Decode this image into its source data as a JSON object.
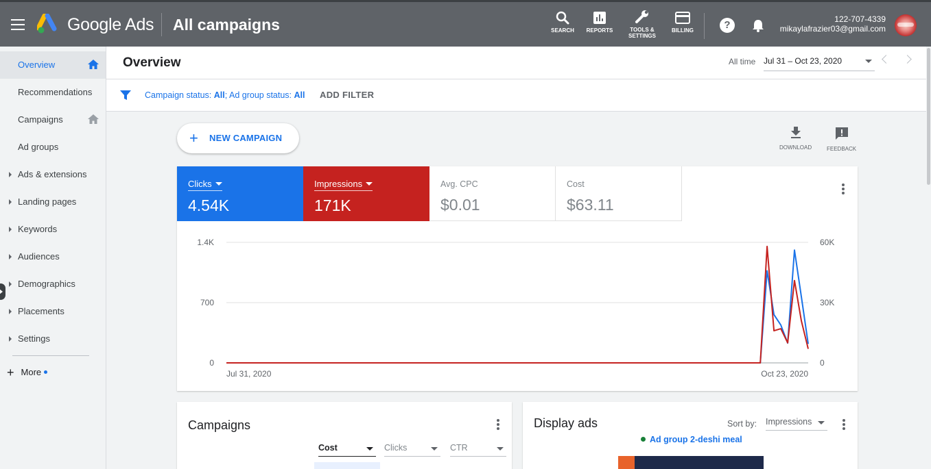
{
  "topbar": {
    "brand": "Google Ads",
    "page_heading": "All campaigns",
    "tools": [
      {
        "label_line1": "SEARCH",
        "label_line2": ""
      },
      {
        "label_line1": "REPORTS",
        "label_line2": ""
      },
      {
        "label_line1": "TOOLS &",
        "label_line2": "SETTINGS"
      },
      {
        "label_line1": "BILLING",
        "label_line2": ""
      }
    ],
    "account_phone": "122-707-4339",
    "account_email": "mikaylafrazier03@gmail.com"
  },
  "sidebar": {
    "items": [
      {
        "label": "Overview"
      },
      {
        "label": "Recommendations"
      },
      {
        "label": "Campaigns"
      },
      {
        "label": "Ad groups"
      },
      {
        "label": "Ads & extensions"
      },
      {
        "label": "Landing pages"
      },
      {
        "label": "Keywords"
      },
      {
        "label": "Audiences"
      },
      {
        "label": "Demographics"
      },
      {
        "label": "Placements"
      },
      {
        "label": "Settings"
      }
    ],
    "more_label": "More"
  },
  "header": {
    "title": "Overview",
    "range_label": "All time",
    "range_value": "Jul 31 – Oct 23, 2020"
  },
  "filter": {
    "campaign_status_label": "Campaign status:",
    "campaign_status_value": "All",
    "ad_group_status_label": "; Ad group status:",
    "ad_group_status_value": "All",
    "add_filter_label": "ADD FILTER"
  },
  "actions": {
    "new_campaign_label": "NEW CAMPAIGN",
    "download_label": "DOWNLOAD",
    "feedback_label": "FEEDBACK"
  },
  "metrics": {
    "clicks_label": "Clicks",
    "clicks_value": "4.54K",
    "impressions_label": "Impressions",
    "impressions_value": "171K",
    "cpc_label": "Avg. CPC",
    "cpc_value": "$0.01",
    "cost_label": "Cost",
    "cost_value": "$63.11"
  },
  "colors": {
    "clicks": "#1a73e8",
    "impressions": "#c5221f"
  },
  "chart_data": {
    "type": "line",
    "x_start_label": "Jul 31, 2020",
    "x_end_label": "Oct 23, 2020",
    "left_axis": {
      "ticks": [
        "1.4K",
        "700",
        "0"
      ],
      "ylim": [
        0,
        1400
      ]
    },
    "right_axis": {
      "ticks": [
        "60K",
        "30K",
        "0"
      ],
      "ylim": [
        0,
        60000
      ]
    },
    "num_days": 85,
    "series": [
      {
        "name": "Clicks",
        "axis": "left",
        "color": "#1a73e8",
        "values": [
          0,
          0,
          0,
          0,
          0,
          0,
          0,
          0,
          0,
          0,
          0,
          0,
          0,
          0,
          0,
          0,
          0,
          0,
          0,
          0,
          0,
          0,
          0,
          0,
          0,
          0,
          0,
          0,
          0,
          0,
          0,
          0,
          0,
          0,
          0,
          0,
          0,
          0,
          0,
          0,
          0,
          0,
          0,
          0,
          0,
          0,
          0,
          0,
          0,
          0,
          0,
          0,
          0,
          0,
          0,
          0,
          0,
          0,
          0,
          0,
          0,
          0,
          0,
          0,
          0,
          0,
          0,
          0,
          0,
          0,
          0,
          0,
          0,
          0,
          0,
          0,
          0,
          0,
          0,
          1070,
          560,
          440,
          230,
          1310,
          770,
          220
        ]
      },
      {
        "name": "Impressions",
        "axis": "right",
        "color": "#c5221f",
        "values": [
          0,
          0,
          0,
          0,
          0,
          0,
          0,
          0,
          0,
          0,
          0,
          0,
          0,
          0,
          0,
          0,
          0,
          0,
          0,
          0,
          0,
          0,
          0,
          0,
          0,
          0,
          0,
          0,
          0,
          0,
          0,
          0,
          0,
          0,
          0,
          0,
          0,
          0,
          0,
          0,
          0,
          0,
          0,
          0,
          0,
          0,
          0,
          0,
          0,
          0,
          0,
          0,
          0,
          0,
          0,
          0,
          0,
          0,
          0,
          0,
          0,
          0,
          0,
          0,
          0,
          0,
          0,
          0,
          0,
          0,
          0,
          0,
          0,
          0,
          0,
          0,
          0,
          0,
          0,
          58000,
          16000,
          17000,
          10000,
          41000,
          21000,
          7000
        ]
      }
    ]
  },
  "campaigns_card": {
    "title": "Campaigns",
    "columns": [
      "Cost",
      "Clicks",
      "CTR"
    ]
  },
  "display_card": {
    "title": "Display ads",
    "sort_label": "Sort by:",
    "sort_value": "Impressions",
    "ad_group": "Ad group 2-deshi meal"
  }
}
